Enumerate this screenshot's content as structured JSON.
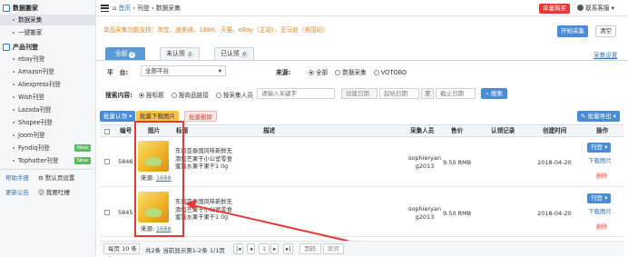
{
  "topbar": {
    "home": "首页",
    "crumb1": "刊登",
    "crumb2": "数据采集",
    "buy_btn": "单量购买",
    "service": "联系客服"
  },
  "sidebar": {
    "group1": "数据搬家",
    "group1_items": [
      "数据采集",
      "一键搬家"
    ],
    "group2": "产品刊登",
    "group2_items": [
      "ebay刊登",
      "Amazon刊登",
      "Aliexpress刊登",
      "Wish刊登",
      "Lazada刊登",
      "Shopee刊登",
      "Joom刊登",
      "Fyndiq刊登",
      "Tophatter刊登"
    ],
    "new_badge": "New",
    "help": "帮助手册",
    "default_settings": "默认页设置",
    "changelog": "更新公告",
    "feedback": "我要吐槽"
  },
  "notice": {
    "text": "单品采集功能支持：淘宝，速卖通，1688，天猫，eBay（主站），亚马逊（美国站）",
    "start_btn": "开始采集",
    "clear_btn": "清空",
    "settings_link": "采集设置"
  },
  "tabs": [
    {
      "label": "全部",
      "count": "2"
    },
    {
      "label": "未认领",
      "count": "2"
    },
    {
      "label": "已认领",
      "count": "0"
    }
  ],
  "filters": {
    "platform_label": "平　台:",
    "platform_value": "全部平台",
    "source_label": "来源:",
    "source_options": [
      "全部",
      "数据采集",
      "VOTOBO"
    ],
    "search_label": "搜索内容:",
    "search_options": [
      "按标题",
      "按商品链接",
      "按采集人员"
    ],
    "keyword_placeholder": "请输入关键字",
    "date_type": "创建日期",
    "start_placeholder": "起始日期",
    "to": "至",
    "end_placeholder": "截止日期",
    "search_btn": "搜索"
  },
  "actions": {
    "batch_claim": "批量认领",
    "batch_download": "批量下载图片",
    "batch_delete": "批量删除",
    "batch_export": "批量导出"
  },
  "table": {
    "headers": [
      "编号",
      "图片",
      "标题",
      "描述",
      "采集人员",
      "售价",
      "认领记录",
      "创建时间",
      "操作"
    ],
    "rows": [
      {
        "id": "5846",
        "title": "东南亚泰国风味新鲜无添加芒果干小公室零食蜜饯水果干果干1 0g",
        "source_label": "来源:",
        "source": "1688",
        "collector": "sophieryan g2013",
        "price": "9.50 RMB",
        "created": "2018-04-20",
        "op_btn": "刊登",
        "op_download": "下载图片",
        "op_delete": "删除"
      },
      {
        "id": "5845",
        "title": "东南亚泰国风味新鲜无添加芒果干小公室零食蜜饯水果干果干1 0g",
        "source_label": "来源:",
        "source": "1688",
        "collector": "sophieryan g2013",
        "price": "9.50 RMB",
        "created": "2018-04-20",
        "op_btn": "刊登",
        "op_download": "下载图片",
        "op_delete": "删除"
      }
    ]
  },
  "pagination": {
    "per_page": "每页 10 条",
    "summary": "共2条 当前显示第1-2条 1/1页",
    "current": "1",
    "page_placeholder": "页码",
    "go": "跳转"
  }
}
